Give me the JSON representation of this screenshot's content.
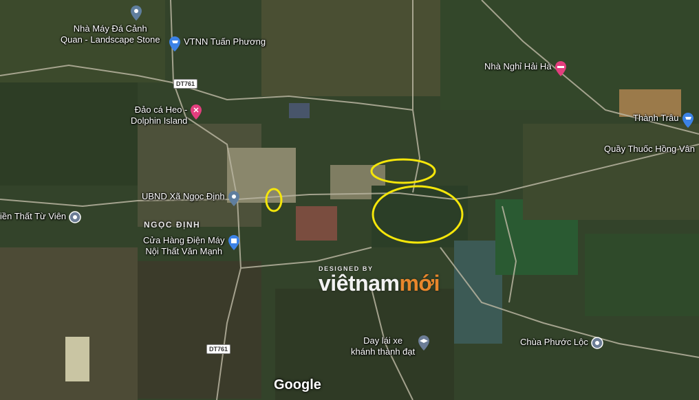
{
  "pois": [
    {
      "id": "landscape-stone",
      "label": "Nhà Máy Đá Cảnh\nQuan - Landscape Stone",
      "icon": "generic-pin-icon",
      "color": "#5f7e9e"
    },
    {
      "id": "vtnn",
      "label": "VTNN Tuấn Phương",
      "icon": "shopping-cart-pin-icon",
      "color": "#3c82e6"
    },
    {
      "id": "dolphin",
      "label": "Đảo cá Heo -\nDolphin Island",
      "icon": "attraction-pin-icon",
      "color": "#e33e7e"
    },
    {
      "id": "nha-nghi",
      "label": "Nhà Nghỉ Hải Hà",
      "icon": "bed-pin-icon",
      "color": "#e33e7e"
    },
    {
      "id": "thanh-trau",
      "label": "Thành Trâu",
      "icon": "shopping-cart-pin-icon",
      "color": "#3c82e6"
    },
    {
      "id": "quay-thuoc",
      "label": "Quầy Thuốc Hồng Vân",
      "icon": "",
      "color": ""
    },
    {
      "id": "ubnd",
      "label": "UBND Xã Ngọc Định",
      "icon": "generic-pin-icon",
      "color": "#5f7e9e"
    },
    {
      "id": "noi-that",
      "label": "iền Thất Từ Viên",
      "icon": "temple-icon",
      "color": "#6c7d96"
    },
    {
      "id": "dien-may",
      "label": "Cửa Hàng Điện Máy\nNội Thất Văn Mạnh",
      "icon": "shopping-bag-pin-icon",
      "color": "#3c82e6"
    },
    {
      "id": "day-lai-xe",
      "label": "Day lái xe\nkhánh thành đạt",
      "icon": "school-pin-icon",
      "color": "#6c7d96"
    },
    {
      "id": "chua",
      "label": "Chùa Phước Lộc",
      "icon": "temple-icon",
      "color": "#6c7d96"
    }
  ],
  "area_label": "NGỌC ĐỊNH",
  "road_shields": [
    "DT761",
    "DT761"
  ],
  "watermark": {
    "small": "DESIGNED BY",
    "big_a": "viêtnam",
    "big_b": "mới"
  },
  "google": "Google",
  "marker_color": "#f5e60a"
}
